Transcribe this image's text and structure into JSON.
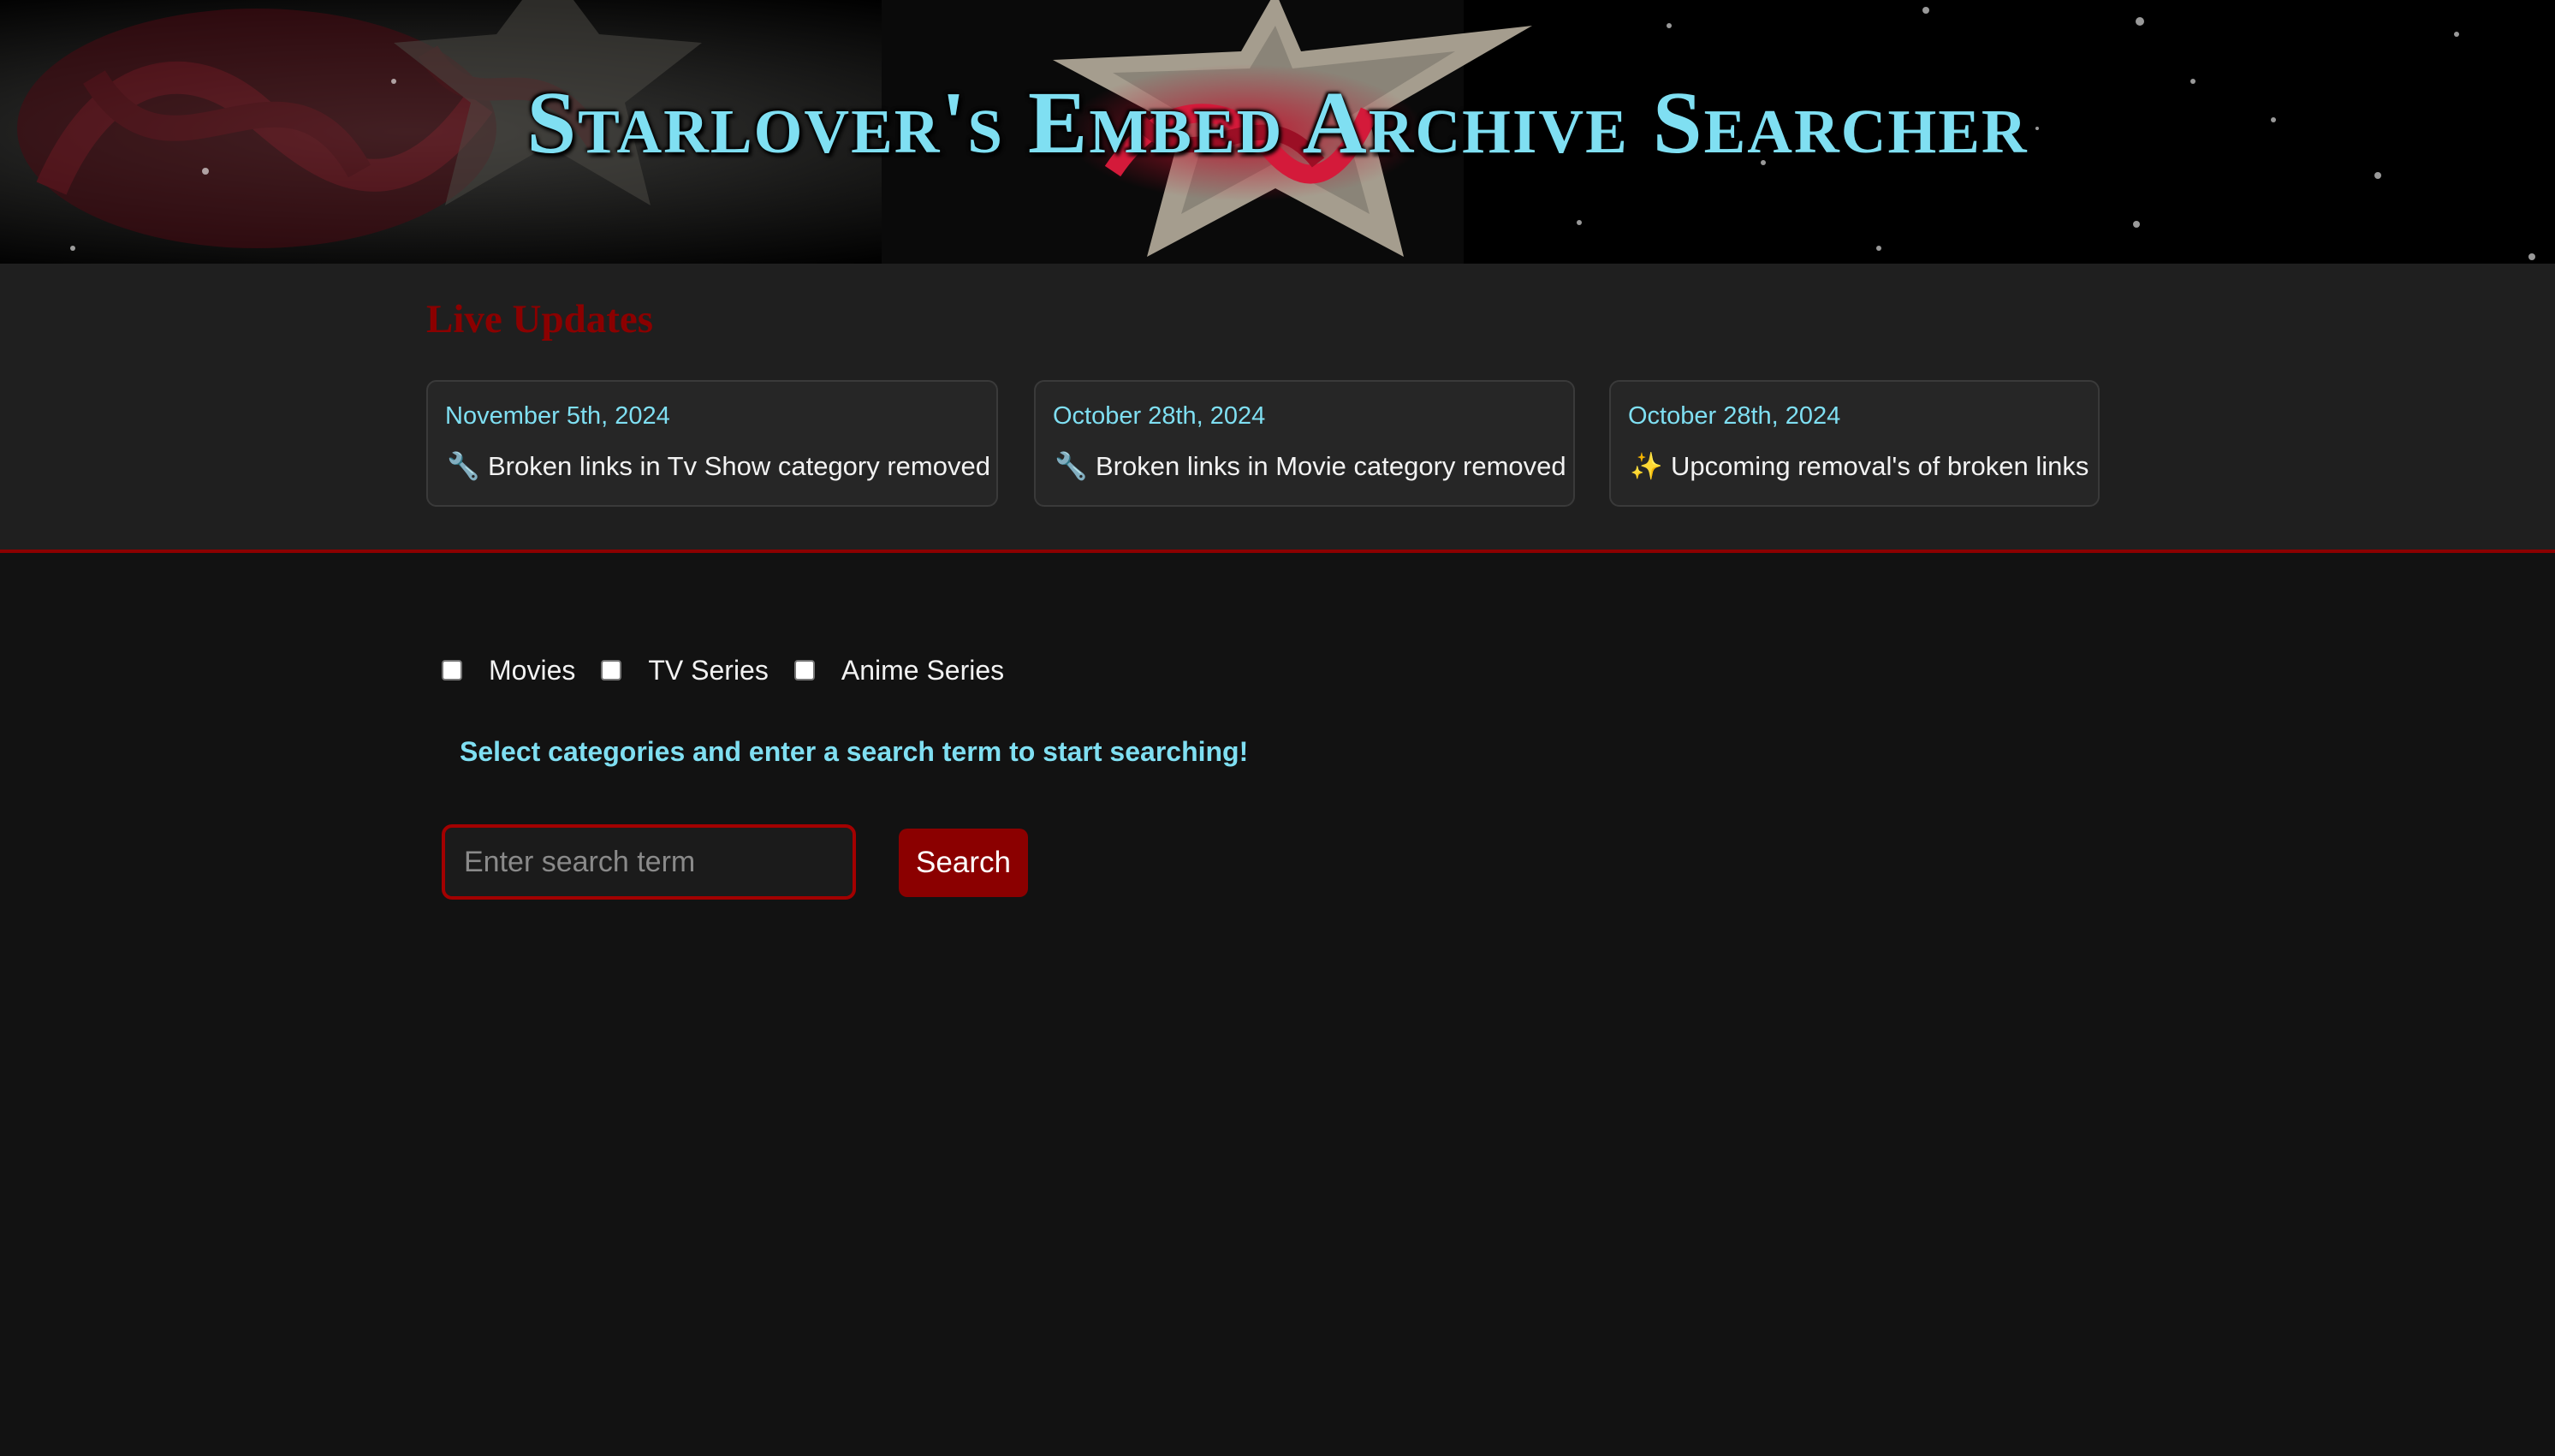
{
  "header": {
    "title": "Starlover's Embed Archive Searcher"
  },
  "updates": {
    "title": "Live Updates",
    "items": [
      {
        "date": "November 5th, 2024",
        "icon": "wrench-icon",
        "glyph": "🔧",
        "text": "Broken links in Tv Show category removed"
      },
      {
        "date": "October 28th, 2024",
        "icon": "wrench-icon",
        "glyph": "🔧",
        "text": "Broken links in Movie category removed"
      },
      {
        "date": "October 28th, 2024",
        "icon": "sparkles-icon",
        "glyph": "✨",
        "text": "Upcoming removal's of broken links"
      }
    ]
  },
  "filters": [
    {
      "label": "Movies",
      "checked": false
    },
    {
      "label": "TV Series",
      "checked": false
    },
    {
      "label": "Anime Series",
      "checked": false
    }
  ],
  "hint": "Select categories and enter a search term to start searching!",
  "search": {
    "placeholder": "Enter search term",
    "value": "",
    "button_label": "Search"
  },
  "colors": {
    "accent": "#8b0000",
    "title": "#7fdff2",
    "background": "#121212",
    "panel": "#1f1f1f"
  }
}
